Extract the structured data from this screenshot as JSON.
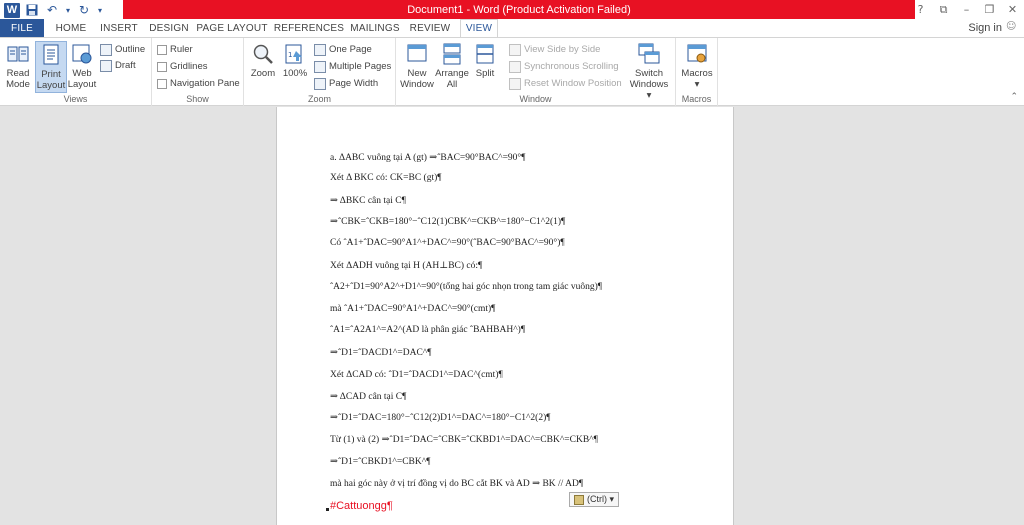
{
  "titlebar": {
    "title": "Document1 - Word (Product Activation Failed)",
    "word_logo": "W",
    "help": "?",
    "ribbon_display": "⧉",
    "minimize": "–",
    "restore": "❐",
    "close": "✕"
  },
  "tabs": {
    "file": "FILE",
    "home": "HOME",
    "insert": "INSERT",
    "design": "DESIGN",
    "page_layout": "PAGE LAYOUT",
    "references": "REFERENCES",
    "mailings": "MAILINGS",
    "review": "REVIEW",
    "view": "VIEW",
    "active": "VIEW"
  },
  "signin": "Sign in",
  "ribbon": {
    "views": {
      "label": "Views",
      "read_mode": [
        "Read",
        "Mode"
      ],
      "print_layout": [
        "Print",
        "Layout"
      ],
      "web_layout": [
        "Web",
        "Layout"
      ],
      "outline": "Outline",
      "draft": "Draft"
    },
    "show": {
      "label": "Show",
      "ruler": "Ruler",
      "gridlines": "Gridlines",
      "navigation_pane": "Navigation Pane"
    },
    "zoom": {
      "label": "Zoom",
      "zoom": "Zoom",
      "hundred": "100%",
      "one_page": "One Page",
      "multiple_pages": "Multiple Pages",
      "page_width": "Page Width"
    },
    "window": {
      "label": "Window",
      "new_window": [
        "New",
        "Window"
      ],
      "arrange_all": [
        "Arrange",
        "All"
      ],
      "split": "Split",
      "view_side_by_side": "View Side by Side",
      "synchronous_scrolling": "Synchronous Scrolling",
      "reset_window_position": "Reset Window Position",
      "switch_windows": [
        "Switch",
        "Windows ▾"
      ]
    },
    "macros": {
      "label": "Macros",
      "macros": [
        "Macros",
        "▾"
      ]
    }
  },
  "document": {
    "lines": [
      "a. ΔABC vuông tại A (gt) ⇒ˆBAC=90°BAC^=90°¶",
      "Xét Δ BKC có: CK=BC (gt)¶",
      "⇒ ΔBKC cân tại C¶",
      "⇒ˆCBK=ˆCKB=180°−ˆC12(1)CBK^=CKB^=180°−C1^2(1)¶",
      "Có ˆA1+ˆDAC=90°A1^+DAC^=90°(ˆBAC=90°BAC^=90°)¶",
      "Xét ΔADH vuông tại H (AH⊥BC) có:¶",
      "ˆA2+ˆD1=90°A2^+D1^=90°(tổng hai góc nhọn trong tam giác vuông)¶",
      "mà ˆA1+ˆDAC=90°A1^+DAC^=90°(cmt)¶",
      "ˆA1=ˆA2A1^=A2^(AD là phân giác ˆBAHBAH^)¶",
      "⇒ˆD1=ˆDACD1^=DAC^¶",
      "Xét ΔCAD có: ˆD1=ˆDACD1^=DAC^(cmt)¶",
      "⇒ ΔCAD cân tại C¶",
      "⇒ˆD1=ˆDAC=180°−ˆC12(2)D1^=DAC^=180°−C1^2(2)¶",
      "Từ (1) và (2) ⇒ˆD1=ˆDAC=ˆCBK=ˆCKBD1^=DAC^=CBK^=CKB^¶",
      "⇒ˆD1=ˆCBKD1^=CBK^¶",
      "mà hai góc này ở vị trí đồng vị do BC cắt BK và AD ⇒ BK // AD¶"
    ],
    "hashtag": "#Cattuongg¶",
    "paste_options": "(Ctrl) ▾"
  }
}
